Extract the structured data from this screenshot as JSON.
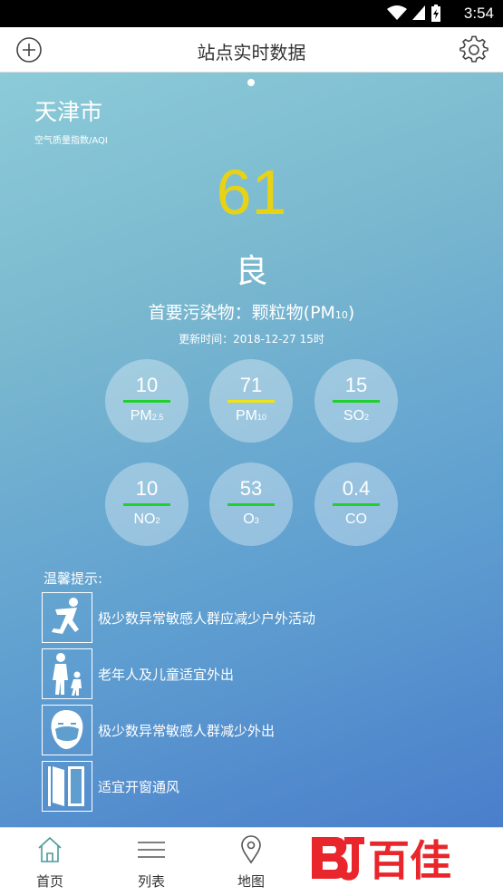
{
  "status_bar": {
    "time": "3:54"
  },
  "header": {
    "title": "站点实时数据"
  },
  "main": {
    "city": "天津市",
    "aqi_label": "空气质量指数/AQI",
    "aqi_value": "61",
    "level": "良",
    "primary_pollutant_prefix": "首要污染物：颗粒物(PM",
    "primary_pollutant_sub": "10",
    "primary_pollutant_suffix": ")",
    "updated": "更新时间：2018-12-27 15时",
    "aqi_color": "#e8d214"
  },
  "pollutants": [
    {
      "value": "10",
      "name": "PM",
      "sub": "2.5",
      "bar_color": "#1fd12a"
    },
    {
      "value": "71",
      "name": "PM",
      "sub": "10",
      "bar_color": "#f0e414"
    },
    {
      "value": "15",
      "name": "SO",
      "sub": "2",
      "bar_color": "#1fd12a"
    },
    {
      "value": "10",
      "name": "NO",
      "sub": "2",
      "bar_color": "#1fd12a"
    },
    {
      "value": "53",
      "name": "O",
      "sub": "3",
      "bar_color": "#1fd12a"
    },
    {
      "value": "0.4",
      "name": "CO",
      "sub": "",
      "bar_color": "#1fd12a"
    }
  ],
  "tips": {
    "title": "温馨提示:",
    "items": [
      {
        "text": "极少数异常敏感人群应减少户外活动",
        "icon": "running-person-icon"
      },
      {
        "text": "老年人及儿童适宜外出",
        "icon": "elder-child-icon"
      },
      {
        "text": "极少数异常敏感人群减少外出",
        "icon": "mask-face-icon"
      },
      {
        "text": "适宜开窗通风",
        "icon": "window-icon"
      }
    ]
  },
  "tabs": [
    {
      "label": "首页",
      "icon": "home-icon"
    },
    {
      "label": "列表",
      "icon": "list-icon"
    },
    {
      "label": "地图",
      "icon": "map-pin-icon"
    }
  ],
  "watermark": {
    "text": "百佳"
  }
}
